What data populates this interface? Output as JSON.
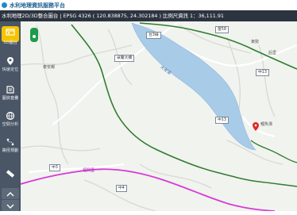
{
  "app": {
    "title": "水利地理資訊服務平台"
  },
  "status": {
    "text": "水利地理2D/3D整合圖台 | EPSG 4326 ( 120.838875, 24.302184 ) 比例尺資訊 1：36,111.91"
  },
  "sidebar": {
    "items": [
      {
        "label": "3D圖台"
      },
      {
        "label": "快速定位"
      },
      {
        "label": "圖資套疊"
      },
      {
        "label": "空間分析"
      },
      {
        "label": "路徑規劃"
      }
    ]
  },
  "map": {
    "labels": [
      {
        "text": "泰安鄉"
      },
      {
        "text": "卓蘭大橋"
      },
      {
        "text": "中13"
      },
      {
        "text": "中13"
      },
      {
        "text": "東勢"
      },
      {
        "text": "中3"
      },
      {
        "text": "中4"
      },
      {
        "text": "台3線"
      },
      {
        "text": "后里"
      },
      {
        "text": "苗58"
      },
      {
        "text": "福興里"
      },
      {
        "text": "大安溪"
      },
      {
        "text": "鯉魚潭"
      }
    ],
    "colors": {
      "water": "#a8cbe8",
      "boundary": "#2f7d2f",
      "road": "#d63ad6",
      "land": "#f1f3ef"
    }
  }
}
